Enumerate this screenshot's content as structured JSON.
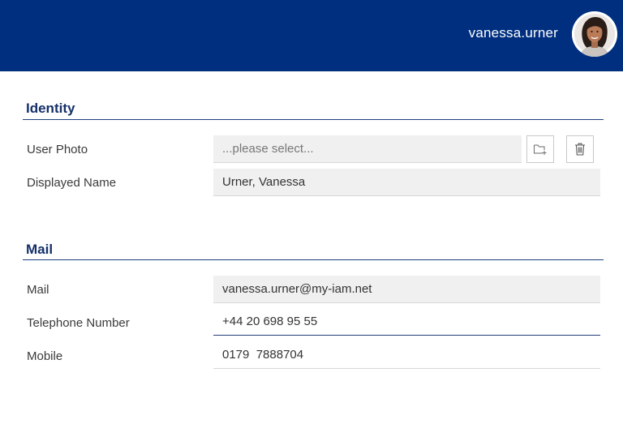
{
  "header": {
    "username": "vanessa.urner",
    "bar_color": "#002f7f",
    "avatar_icon": "user-avatar-photo"
  },
  "sections": {
    "identity": {
      "title": "Identity",
      "user_photo_label": "User Photo",
      "user_photo_placeholder": "...please select...",
      "select_icon": "folder-add-icon",
      "delete_icon": "trash-icon",
      "displayed_name_label": "Displayed Name",
      "displayed_name_value": "Urner, Vanessa"
    },
    "mail": {
      "title": "Mail",
      "mail_label": "Mail",
      "mail_value": "vanessa.urner@my-iam.net",
      "telephone_label": "Telephone Number",
      "telephone_value": "+44 20 698 95 55",
      "mobile_label": "Mobile",
      "mobile_value": "0179  7888704"
    }
  }
}
